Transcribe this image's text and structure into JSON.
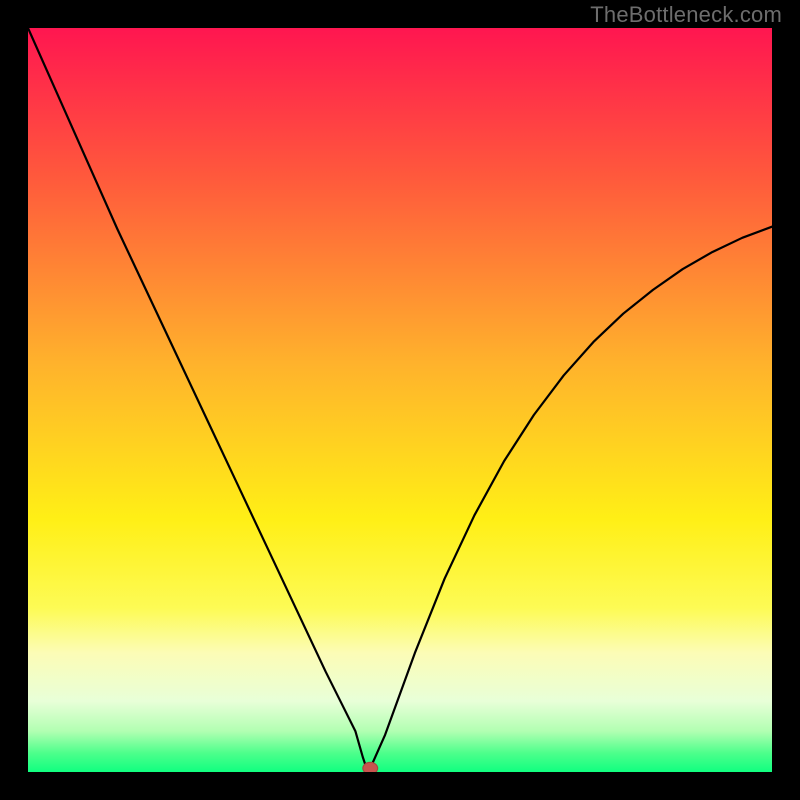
{
  "watermark_text": "TheBottleneck.com",
  "chart_data": {
    "type": "line",
    "title": "",
    "xlabel": "",
    "ylabel": "",
    "xlim": [
      0,
      100
    ],
    "ylim": [
      0,
      100
    ],
    "grid": false,
    "background_gradient_vertical": [
      {
        "stop": 0.0,
        "color": "#ff1650"
      },
      {
        "stop": 0.2,
        "color": "#ff593c"
      },
      {
        "stop": 0.45,
        "color": "#ffb22c"
      },
      {
        "stop": 0.66,
        "color": "#ffef16"
      },
      {
        "stop": 0.78,
        "color": "#fdfb55"
      },
      {
        "stop": 0.84,
        "color": "#fcfcb6"
      },
      {
        "stop": 0.905,
        "color": "#e8ffd8"
      },
      {
        "stop": 0.945,
        "color": "#b2ffb2"
      },
      {
        "stop": 0.975,
        "color": "#4cff8b"
      },
      {
        "stop": 1.0,
        "color": "#10ff80"
      }
    ],
    "series": [
      {
        "name": "bottleneck-curve",
        "color": "#000000",
        "width": 2.2,
        "x": [
          0,
          4,
          8,
          12,
          16,
          20,
          24,
          28,
          32,
          36,
          40,
          42,
          44,
          45,
          45.5,
          46,
          48,
          52,
          56,
          60,
          64,
          68,
          72,
          76,
          80,
          84,
          88,
          92,
          96,
          100
        ],
        "values": [
          100,
          91,
          82,
          73,
          64.5,
          56,
          47.5,
          39,
          30.5,
          22,
          13.5,
          9.5,
          5.5,
          2,
          0.5,
          0.5,
          5,
          16,
          26,
          34.5,
          41.8,
          48,
          53.3,
          57.8,
          61.6,
          64.8,
          67.6,
          69.9,
          71.8,
          73.3
        ]
      }
    ],
    "marker": {
      "name": "optimal-point",
      "x": 46,
      "y": 0.5,
      "rx": 1.0,
      "ry": 0.8,
      "fill": "#c9544e",
      "stroke": "#a6493f"
    }
  }
}
